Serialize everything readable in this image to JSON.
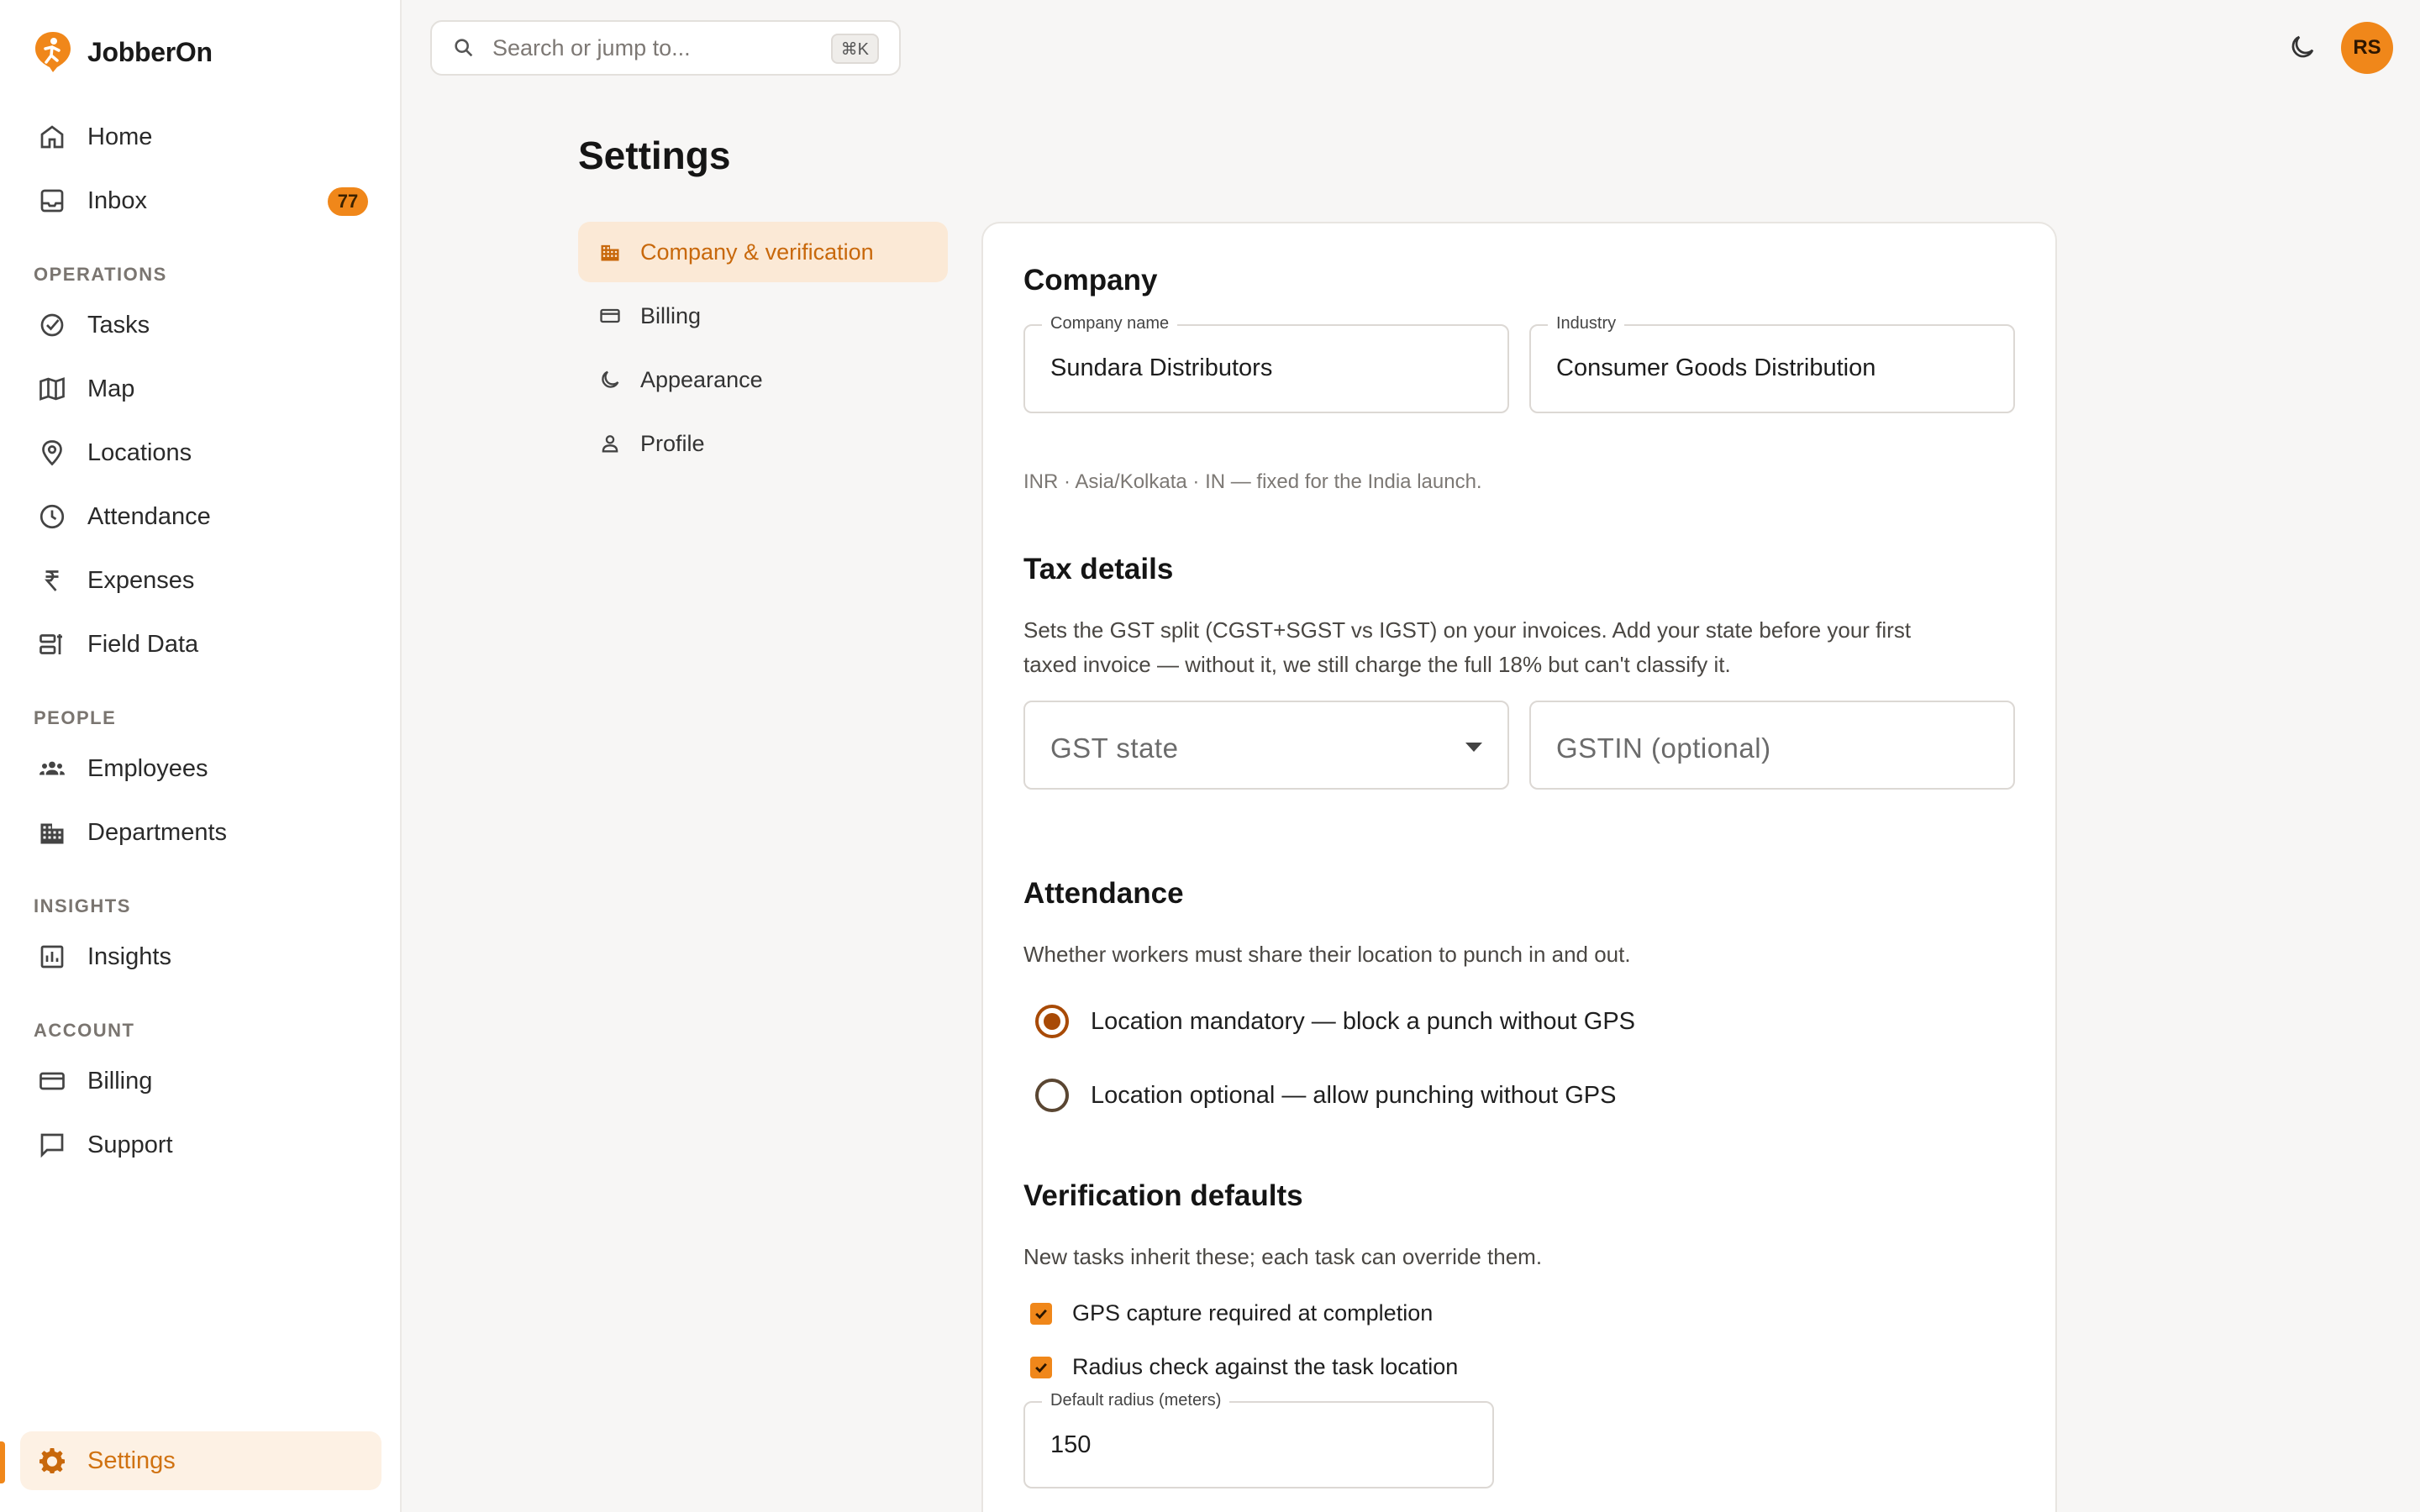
{
  "app": {
    "name": "JobberOn"
  },
  "sidebar": {
    "items": [
      {
        "label": "Home"
      },
      {
        "label": "Inbox",
        "badge": "77"
      },
      {
        "label": "Tasks"
      },
      {
        "label": "Map"
      },
      {
        "label": "Locations"
      },
      {
        "label": "Attendance"
      },
      {
        "label": "Expenses"
      },
      {
        "label": "Field Data"
      },
      {
        "label": "Employees"
      },
      {
        "label": "Departments"
      },
      {
        "label": "Insights"
      },
      {
        "label": "Billing"
      },
      {
        "label": "Support"
      },
      {
        "label": "Settings"
      }
    ],
    "sections": [
      "OPERATIONS",
      "PEOPLE",
      "INSIGHTS",
      "ACCOUNT"
    ]
  },
  "topbar": {
    "search_placeholder": "Search or jump to...",
    "shortcut": "⌘K",
    "avatar_initials": "RS"
  },
  "page": {
    "title": "Settings"
  },
  "settings_nav": [
    {
      "label": "Company & verification"
    },
    {
      "label": "Billing"
    },
    {
      "label": "Appearance"
    },
    {
      "label": "Profile"
    }
  ],
  "company": {
    "heading": "Company",
    "name_label": "Company name",
    "name_value": "Sundara Distributors",
    "industry_label": "Industry",
    "industry_value": "Consumer Goods Distribution",
    "locale_note": "INR · Asia/Kolkata · IN — fixed for the India launch."
  },
  "tax": {
    "heading": "Tax details",
    "description_line1": "Sets the GST split (CGST+SGST vs IGST) on your invoices. Add your state before your first",
    "description_line2": "taxed invoice — without it, we still charge the full 18% but can't classify it.",
    "state_placeholder": "GST state",
    "gstin_placeholder": "GSTIN (optional)"
  },
  "attendance": {
    "heading": "Attendance",
    "description": "Whether workers must share their location to punch in and out.",
    "option_mandatory": "Location mandatory — block a punch without GPS",
    "option_optional": "Location optional — allow punching without GPS"
  },
  "verification": {
    "heading": "Verification defaults",
    "description": "New tasks inherit these; each task can override them.",
    "gps_label": "GPS capture required at completion",
    "radius_check_label": "Radius check against the task location",
    "radius_label": "Default radius (meters)",
    "radius_value": "150"
  },
  "colors": {
    "accent": "#f0871a",
    "accent_text": "#c8680b",
    "active_bg": "#fdf1e4"
  }
}
